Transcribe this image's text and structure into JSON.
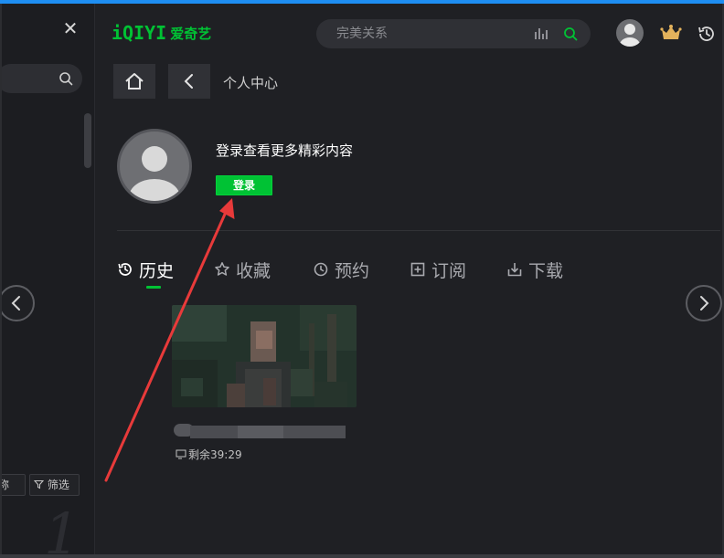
{
  "window": {
    "close_glyph": "✕"
  },
  "left_panel": {
    "chip_name_label": "称",
    "chip_filter_label": "筛选",
    "page_number": "1"
  },
  "header": {
    "logo_mark": "iQIYI",
    "logo_text": "爱奇艺",
    "search_placeholder": "完美关系",
    "icons": [
      "search-icon",
      "voice-bars-icon",
      "avatar-icon",
      "vip-crown-icon",
      "history-icon"
    ]
  },
  "breadcrumb": {
    "title": "个人中心"
  },
  "profile": {
    "prompt": "登录查看更多精彩内容",
    "login_label": "登录"
  },
  "tabs": [
    {
      "label": "历史",
      "icon": "clock-icon",
      "active": true
    },
    {
      "label": "收藏",
      "icon": "star-icon",
      "active": false
    },
    {
      "label": "预约",
      "icon": "clock-outline-icon",
      "active": false
    },
    {
      "label": "订阅",
      "icon": "plus-square-icon",
      "active": false
    },
    {
      "label": "下载",
      "icon": "download-icon",
      "active": false
    }
  ],
  "history": {
    "items": [
      {
        "remaining": "剩余39:29"
      }
    ]
  },
  "colors": {
    "brand_green": "#00c234",
    "annotation_red": "#e83a3a",
    "background": "#1f2024"
  }
}
